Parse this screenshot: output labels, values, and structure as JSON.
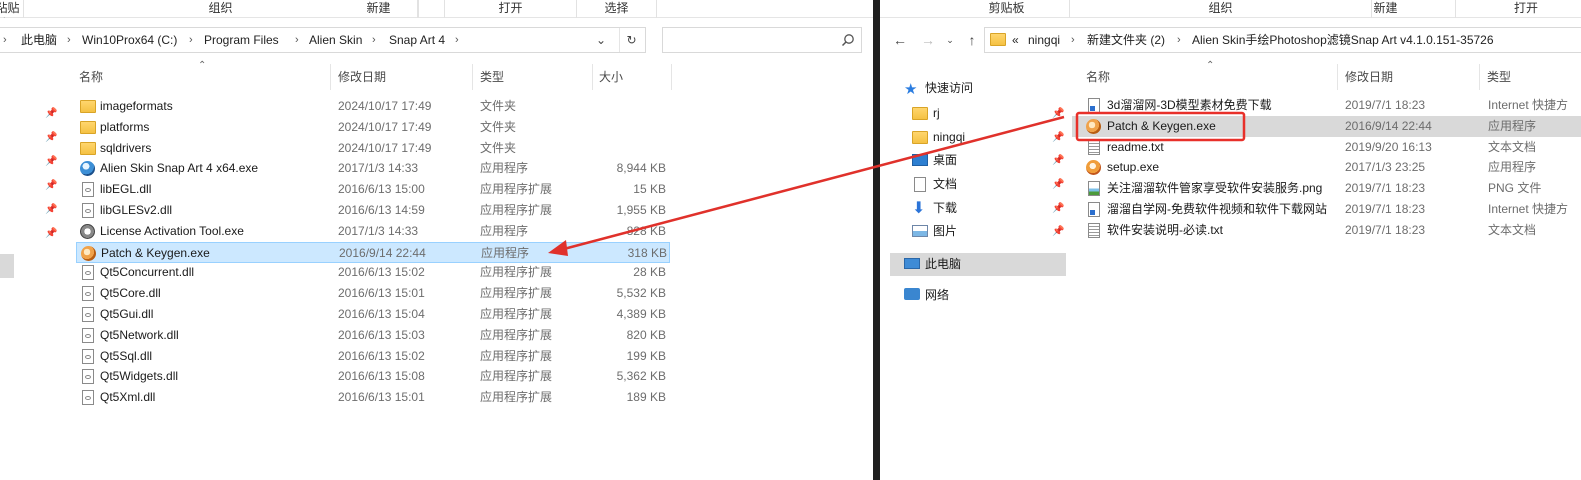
{
  "left_window": {
    "ribbon": [
      "粘贴板",
      "组织",
      "新建",
      "打开",
      "选择"
    ],
    "address": [
      "此电脑",
      "Win10Prox64 (C:)",
      "Program Files",
      "Alien Skin",
      "Snap Art 4"
    ],
    "columns": {
      "name": "名称",
      "date": "修改日期",
      "type": "类型",
      "size": "大小"
    },
    "files": [
      {
        "name": "imageformats",
        "date": "2024/10/17 17:49",
        "type": "文件夹",
        "size": "",
        "icon": "folder-icon"
      },
      {
        "name": "platforms",
        "date": "2024/10/17 17:49",
        "type": "文件夹",
        "size": "",
        "icon": "folder-icon"
      },
      {
        "name": "sqldrivers",
        "date": "2024/10/17 17:49",
        "type": "文件夹",
        "size": "",
        "icon": "folder-icon"
      },
      {
        "name": "Alien Skin Snap Art 4 x64.exe",
        "date": "2017/1/3 14:33",
        "type": "应用程序",
        "size": "8,944 KB",
        "icon": "app-globe-icon"
      },
      {
        "name": "libEGL.dll",
        "date": "2016/6/13 15:00",
        "type": "应用程序扩展",
        "size": "15 KB",
        "icon": "dll-icon"
      },
      {
        "name": "libGLESv2.dll",
        "date": "2016/6/13 14:59",
        "type": "应用程序扩展",
        "size": "1,955 KB",
        "icon": "dll-icon"
      },
      {
        "name": "License Activation Tool.exe",
        "date": "2017/1/3 14:33",
        "type": "应用程序",
        "size": "828 KB",
        "icon": "license-tool-icon"
      },
      {
        "name": "Patch & Keygen.exe",
        "date": "2016/9/14 22:44",
        "type": "应用程序",
        "size": "318 KB",
        "icon": "keygen-icon"
      },
      {
        "name": "Qt5Concurrent.dll",
        "date": "2016/6/13 15:02",
        "type": "应用程序扩展",
        "size": "28 KB",
        "icon": "dll-icon"
      },
      {
        "name": "Qt5Core.dll",
        "date": "2016/6/13 15:01",
        "type": "应用程序扩展",
        "size": "5,532 KB",
        "icon": "dll-icon"
      },
      {
        "name": "Qt5Gui.dll",
        "date": "2016/6/13 15:04",
        "type": "应用程序扩展",
        "size": "4,389 KB",
        "icon": "dll-icon"
      },
      {
        "name": "Qt5Network.dll",
        "date": "2016/6/13 15:03",
        "type": "应用程序扩展",
        "size": "820 KB",
        "icon": "dll-icon"
      },
      {
        "name": "Qt5Sql.dll",
        "date": "2016/6/13 15:02",
        "type": "应用程序扩展",
        "size": "199 KB",
        "icon": "dll-icon"
      },
      {
        "name": "Qt5Widgets.dll",
        "date": "2016/6/13 15:08",
        "type": "应用程序扩展",
        "size": "5,362 KB",
        "icon": "dll-icon"
      },
      {
        "name": "Qt5Xml.dll",
        "date": "2016/6/13 15:01",
        "type": "应用程序扩展",
        "size": "189 KB",
        "icon": "dll-icon"
      }
    ]
  },
  "right_window": {
    "ribbon": [
      "剪贴板",
      "组织",
      "新建",
      "打开"
    ],
    "address_prefix": "«",
    "address": [
      "ningqi",
      "新建文件夹 (2)",
      "Alien Skin手绘Photoshop滤镜Snap Art v4.1.0.151-35726"
    ],
    "nav": [
      {
        "label": "快速访问",
        "icon": "star-icon"
      },
      {
        "label": "rj",
        "icon": "folder-icon"
      },
      {
        "label": "ningqi",
        "icon": "folder-icon"
      },
      {
        "label": "桌面",
        "icon": "desktop-icon"
      },
      {
        "label": "文档",
        "icon": "documents-icon"
      },
      {
        "label": "下载",
        "icon": "download-icon"
      },
      {
        "label": "图片",
        "icon": "pictures-icon"
      },
      {
        "label": "此电脑",
        "icon": "this-pc-icon"
      },
      {
        "label": "网络",
        "icon": "network-icon"
      }
    ],
    "columns": {
      "name": "名称",
      "date": "修改日期",
      "type": "类型"
    },
    "files": [
      {
        "name": "3d溜溜网-3D模型素材免费下载",
        "date": "2019/7/1 18:23",
        "type": "Internet 快捷方",
        "icon": "shortcut-icon"
      },
      {
        "name": "Patch & Keygen.exe",
        "date": "2016/9/14 22:44",
        "type": "应用程序",
        "icon": "keygen-icon"
      },
      {
        "name": "readme.txt",
        "date": "2019/9/20 16:13",
        "type": "文本文档",
        "icon": "text-file-icon"
      },
      {
        "name": "setup.exe",
        "date": "2017/1/3 23:25",
        "type": "应用程序",
        "icon": "setup-icon"
      },
      {
        "name": "关注溜溜软件管家享受软件安装服务.png",
        "date": "2019/7/1 18:23",
        "type": "PNG 文件",
        "icon": "image-file-icon"
      },
      {
        "name": "溜溜自学网-免费软件视频和软件下载网站",
        "date": "2019/7/1 18:23",
        "type": "Internet 快捷方",
        "icon": "shortcut-icon"
      },
      {
        "name": "软件安装说明-必读.txt",
        "date": "2019/7/1 18:23",
        "type": "文本文档",
        "icon": "text-file-icon"
      }
    ]
  },
  "colors": {
    "selection": "#cce8ff",
    "highlight_box": "#e8302a",
    "arrow": "#e0312b"
  }
}
